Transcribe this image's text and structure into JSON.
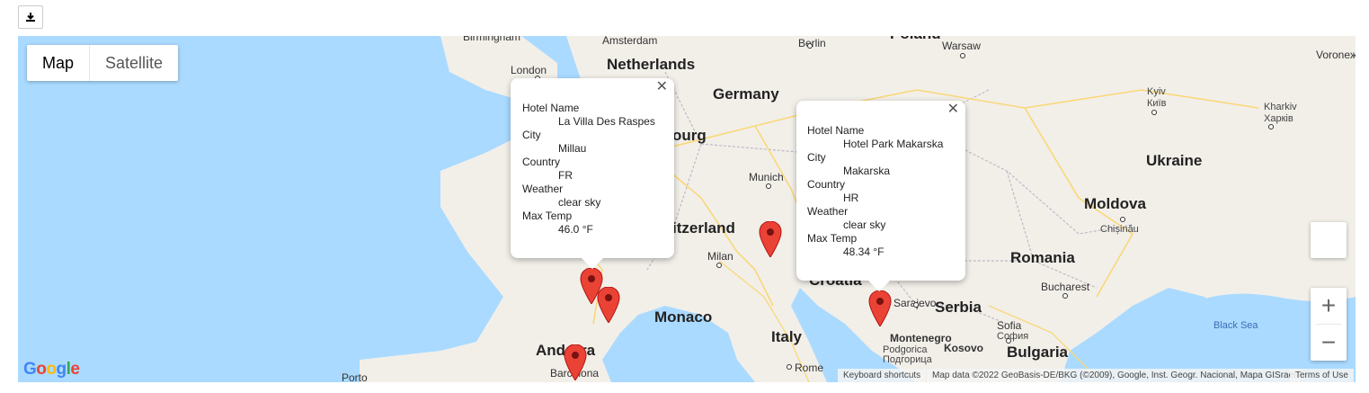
{
  "download_icon": "download-icon",
  "map_type": {
    "map": "Map",
    "satellite": "Satellite",
    "active": "map"
  },
  "countries": [
    "Netherlands",
    "Germany",
    "Ukraine",
    "Moldova",
    "Romania",
    "Serbia",
    "Bulgaria",
    "Italy",
    "Monaco",
    "Andorra",
    "Croatia",
    "Poland"
  ],
  "country_partial": {
    "switzerland": "itzerland",
    "luxembourg": "ourg"
  },
  "cities": {
    "birmingham": "Birmingham",
    "amsterdam": "Amsterdam",
    "london": "London",
    "berlin": "Berlin",
    "warsaw": "Warsaw",
    "kyiv": "Kyiv",
    "kyiv_local": "Київ",
    "kharkiv": "Kharkiv",
    "kharkiv_local": "Харків",
    "voronezh": "Voroneж",
    "munich": "Munich",
    "milan": "Milan",
    "chisinau": "Chișinău",
    "bucharest": "Bucharest",
    "sarajevo": "Sarajevo",
    "montenegro": "Montenegro",
    "podgorica": "Podgorica",
    "podgorica_local": "Подгорица",
    "sofia": "Sofia",
    "sofia_local": "София",
    "kosovo": "Kosovo",
    "rome": "Rome",
    "barcelona": "Barcelona",
    "porto": "Porto",
    "black_sea": "Black Sea"
  },
  "info_windows": [
    {
      "hotel_name_label": "Hotel Name",
      "hotel_name": "La Villa Des Raspes",
      "city_label": "City",
      "city": "Millau",
      "country_label": "Country",
      "country": "FR",
      "weather_label": "Weather",
      "weather": "clear sky",
      "max_temp_label": "Max Temp",
      "max_temp": "46.0 °F"
    },
    {
      "hotel_name_label": "Hotel Name",
      "hotel_name": "Hotel Park Makarska",
      "city_label": "City",
      "city": "Makarska",
      "country_label": "Country",
      "country": "HR",
      "weather_label": "Weather",
      "weather": "clear sky",
      "max_temp_label": "Max Temp",
      "max_temp": "48.34 °F"
    }
  ],
  "markers": [
    "Millau",
    "Montpellier area",
    "Barcelona",
    "Northern Italy",
    "Makarska"
  ],
  "zoom": {
    "in": "+",
    "out": "−"
  },
  "attribution": {
    "shortcuts": "Keyboard shortcuts",
    "data": "Map data ©2022 GeoBasis-DE/BKG (©2009), Google, Inst. Geogr. Nacional, Mapa GISrael",
    "terms": "Terms of Use"
  },
  "logo": "Google",
  "colors": {
    "water": "#aadaff",
    "land": "#f2efe9",
    "pin": "#ea4335",
    "border": "#bbbbbb"
  }
}
